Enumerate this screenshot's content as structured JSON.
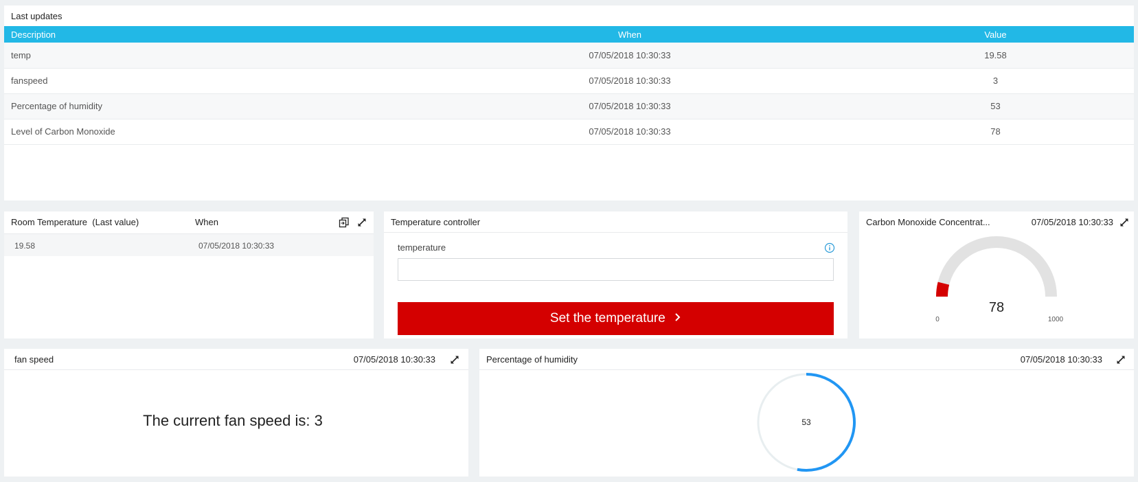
{
  "updates": {
    "title": "Last updates",
    "headers": [
      "Description",
      "When",
      "Value"
    ],
    "rows": [
      {
        "description": "temp",
        "when": "07/05/2018 10:30:33",
        "value": "19.58"
      },
      {
        "description": "fanspeed",
        "when": "07/05/2018 10:30:33",
        "value": "3"
      },
      {
        "description": "Percentage of humidity",
        "when": "07/05/2018 10:30:33",
        "value": "53"
      },
      {
        "description": "Level of Carbon Monoxide",
        "when": "07/05/2018 10:30:33",
        "value": "78"
      }
    ]
  },
  "room": {
    "title": "Room Temperature  (Last value)",
    "when_header": "When",
    "value": "19.58",
    "when": "07/05/2018 10:30:33",
    "icons": [
      "copy-icon",
      "expand-icon"
    ]
  },
  "controller": {
    "title": "Temperature controller",
    "field_label": "temperature",
    "field_value": "",
    "button_label": "Set the temperature",
    "button_color": "#d40000",
    "icons": [
      "info-icon",
      "chevron-right-icon"
    ]
  },
  "co": {
    "title": "Carbon Monoxide Concentrat...",
    "when": "07/05/2018 10:30:33",
    "gauge": {
      "value": 78,
      "min": 0,
      "max": 1000,
      "value_label": "78",
      "min_label": "0",
      "max_label": "1000",
      "fill_color": "#d40000",
      "track_color": "#e2e2e2"
    }
  },
  "fan": {
    "title": "fan speed",
    "when": "07/05/2018 10:30:33",
    "text": "The current fan speed is: 3"
  },
  "humidity": {
    "title": "Percentage of humidity",
    "when": "07/05/2018 10:30:33",
    "dial": {
      "value": 53,
      "max": 100,
      "value_label": "53",
      "fill_color": "#2196f3",
      "track_color": "#e8eef0"
    }
  },
  "colors": {
    "header_blue": "#22b8e6",
    "accent_red": "#d40000"
  }
}
